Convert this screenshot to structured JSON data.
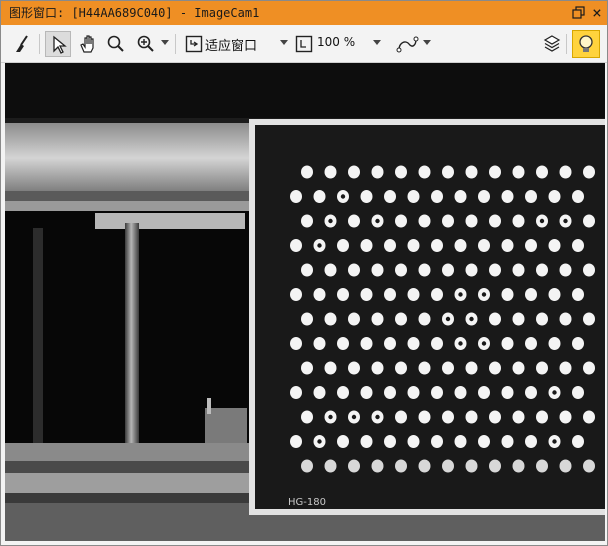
{
  "window": {
    "title": "图形窗口: [H44AA689C040] - ImageCam1",
    "restore_icon": "restore-icon",
    "close_glyph": "×"
  },
  "toolbar": {
    "fit_label": "适应窗口",
    "zoom_label": "100 %",
    "icons": [
      "clear-brush-icon",
      "pointer-icon",
      "pan-hand-icon",
      "magnifier-icon",
      "zoom-in-icon",
      "fit-window-icon",
      "zoom-box-icon",
      "shape-draw-icon",
      "layers-icon",
      "lightbulb-icon"
    ]
  },
  "image": {
    "board_label": "HG-180",
    "board_grid": {
      "rows": 13,
      "cols": 14
    }
  },
  "colors": {
    "titlebar": "#ef8f24",
    "bulb": "#ffd33d"
  }
}
